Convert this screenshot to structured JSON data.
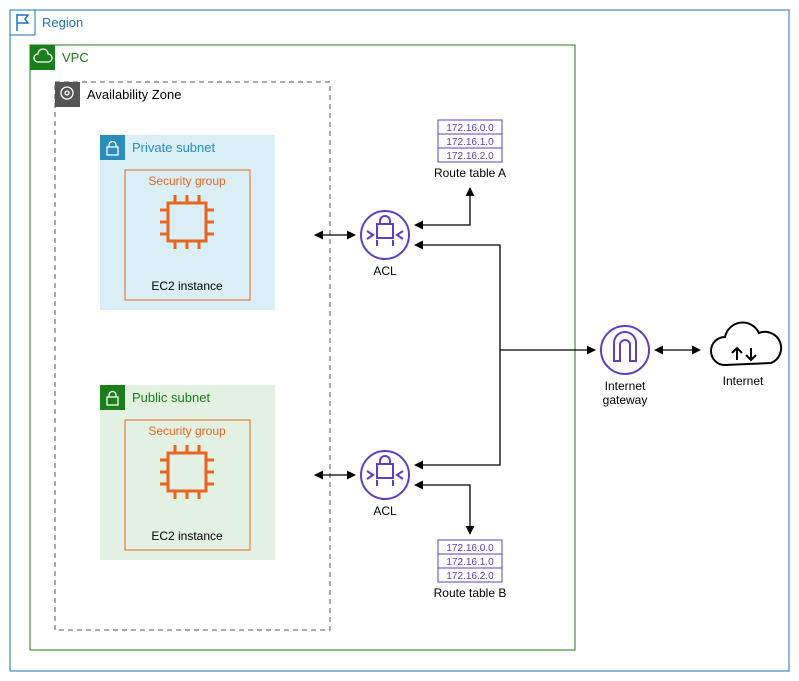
{
  "region": {
    "label": "Region"
  },
  "vpc": {
    "label": "VPC"
  },
  "az": {
    "label": "Availability Zone"
  },
  "subnets": {
    "private": {
      "label": "Private subnet"
    },
    "public": {
      "label": "Public subnet"
    }
  },
  "sg": {
    "label": "Security group"
  },
  "ec2": {
    "label": "EC2 instance"
  },
  "acl": {
    "label": "ACL"
  },
  "route_tables": {
    "a": {
      "label": "Route table A",
      "entries": [
        "172.16.0.0",
        "172.16.1.0",
        "172.16.2.0"
      ]
    },
    "b": {
      "label": "Route table B",
      "entries": [
        "172.16.0.0",
        "172.16.1.0",
        "172.16.2.0"
      ]
    }
  },
  "igw": {
    "label": "Internet\ngateway"
  },
  "internet": {
    "label": "Internet"
  }
}
